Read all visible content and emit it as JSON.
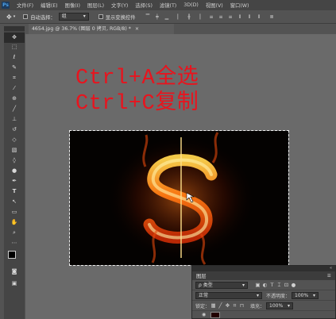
{
  "app": {
    "logo": "Ps"
  },
  "menu": [
    "文件(F)",
    "编辑(E)",
    "图像(I)",
    "图层(L)",
    "文字(Y)",
    "选择(S)",
    "滤镜(T)",
    "3D(D)",
    "视图(V)",
    "窗口(W)"
  ],
  "options": {
    "auto_select_label": "自动选择：",
    "auto_select_value": "组",
    "show_transform_label": "显示变换控件"
  },
  "document": {
    "tab_title": "4654.jpg @ 36.7% (图层 0 拷贝, RGB/8) *",
    "close_glyph": "×"
  },
  "caption": {
    "line1": "Ctrl+A全选",
    "line2": "Ctrl+C复制",
    "color": "#e8141e"
  },
  "layers_panel": {
    "tab": "图层",
    "filter_value": "ρ 类型",
    "blend_mode": "正常",
    "opacity_label": "不透明度：",
    "opacity_value": "100%",
    "lock_label": "锁定：",
    "fill_label": "填充：",
    "fill_value": "100%"
  },
  "icons": [
    "move-icon",
    "marquee-icon",
    "lasso-icon",
    "quick-select-icon",
    "crop-icon",
    "eyedropper-icon",
    "healing-icon",
    "brush-icon",
    "stamp-icon",
    "history-brush-icon",
    "eraser-icon",
    "gradient-icon",
    "blur-icon",
    "dodge-icon",
    "pen-icon",
    "type-icon",
    "path-select-icon",
    "rectangle-icon",
    "hand-icon",
    "zoom-icon"
  ]
}
